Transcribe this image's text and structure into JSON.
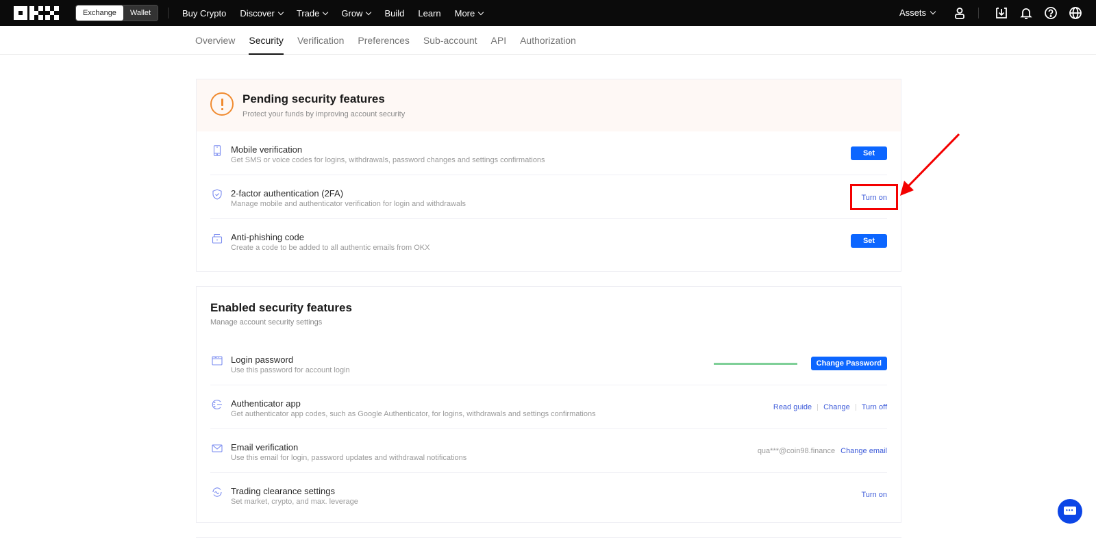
{
  "topnav": {
    "logo_alt": "OKX",
    "switch": {
      "exchange": "Exchange",
      "wallet": "Wallet",
      "active": "Exchange"
    },
    "links": [
      {
        "label": "Buy Crypto",
        "dropdown": false
      },
      {
        "label": "Discover",
        "dropdown": true
      },
      {
        "label": "Trade",
        "dropdown": true
      },
      {
        "label": "Grow",
        "dropdown": true
      },
      {
        "label": "Build",
        "dropdown": false
      },
      {
        "label": "Learn",
        "dropdown": false
      },
      {
        "label": "More",
        "dropdown": true
      }
    ],
    "assets": "Assets",
    "icons": [
      "user-icon",
      "download-icon",
      "bell-icon",
      "help-icon",
      "globe-icon"
    ]
  },
  "tabs": [
    {
      "label": "Overview",
      "active": false
    },
    {
      "label": "Security",
      "active": true
    },
    {
      "label": "Verification",
      "active": false
    },
    {
      "label": "Preferences",
      "active": false
    },
    {
      "label": "Sub-account",
      "active": false
    },
    {
      "label": "API",
      "active": false
    },
    {
      "label": "Authorization",
      "active": false
    }
  ],
  "pending": {
    "title": "Pending security features",
    "subtitle": "Protect your funds by improving account security",
    "items": [
      {
        "icon": "mobile-icon",
        "title": "Mobile verification",
        "desc": "Get SMS or voice codes for logins, withdrawals, password changes and settings confirmations",
        "action": "Set"
      },
      {
        "icon": "shield-icon",
        "title": "2-factor authentication (2FA)",
        "desc": "Manage mobile and authenticator verification for login and withdrawals",
        "action": "Turn on",
        "highlighted": true
      },
      {
        "icon": "lock-icon",
        "title": "Anti-phishing code",
        "desc": "Create a code to be added to all authentic emails from OKX",
        "action": "Set"
      }
    ]
  },
  "enabled": {
    "title": "Enabled security features",
    "subtitle": "Manage account security settings",
    "items": [
      {
        "icon": "password-icon",
        "title": "Login password",
        "desc": "Use this password for account login",
        "action": "Change Password",
        "strength": "strong"
      },
      {
        "icon": "authenticator-icon",
        "title": "Authenticator app",
        "desc": "Get authenticator app codes, such as Google Authenticator, for logins, withdrawals and settings confirmations",
        "links": [
          "Read guide",
          "Change",
          "Turn off"
        ]
      },
      {
        "icon": "mail-icon",
        "title": "Email verification",
        "desc": "Use this email for login, password updates and withdrawal notifications",
        "value": "qua***@coin98.finance",
        "action": "Change email"
      },
      {
        "icon": "trading-icon",
        "title": "Trading clearance settings",
        "desc": "Set market, crypto, and max. leverage",
        "action": "Turn on"
      }
    ]
  },
  "colors": {
    "accent": "#0c66ff",
    "link": "#3d5bd9",
    "warning": "#f08a2f",
    "highlight": "#f40000",
    "strength": "#7ecf97"
  }
}
